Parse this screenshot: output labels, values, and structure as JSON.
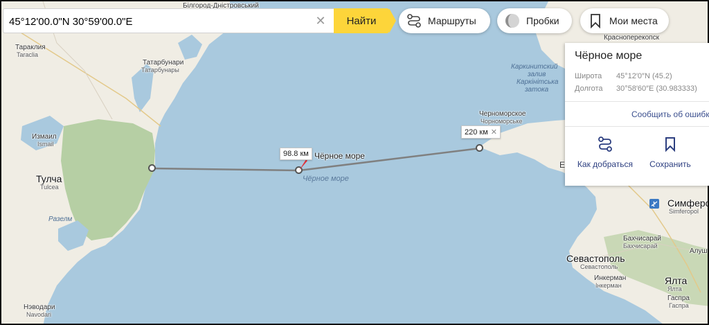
{
  "search": {
    "value": "45°12'00.0\"N 30°59'00.0\"E",
    "clear_icon": "close-icon",
    "find_label": "Найти"
  },
  "toolbar": {
    "routes_label": "Маршруты",
    "routes_icon": "route-icon",
    "traffic_label": "Пробки",
    "traffic_icon": "traffic-circle-icon",
    "places_label": "Мои места",
    "places_icon": "bookmark-icon"
  },
  "panel": {
    "title": "Чёрное море",
    "lat_label": "Широта",
    "lat_value": "45°12′0″N (45.2)",
    "lon_label": "Долгота",
    "lon_value": "30°58′60″E (30.983333)",
    "report_link": "Сообщить об ошибке",
    "route_label": "Как добраться",
    "save_label": "Сохранить"
  },
  "ruler": {
    "segment1_label": "98.8 км",
    "segment2_label": "220 км",
    "remove_icon": "close-icon"
  },
  "map_labels": {
    "bilgorod": "Білгород-Дністровський",
    "tarakliya": "Тараклия",
    "taraclia": "Taraclia",
    "tatarbunary_ua": "Татарбунари",
    "tatarbunary_ru": "Татарбунары",
    "izmail": "Измаил",
    "izmail_ro": "Ismail",
    "tulcha": "Тулча",
    "tulcea": "Tulcea",
    "razelm": "Разелм",
    "navodari": "Нэводари",
    "navodari_ro": "Navodari",
    "black_sea_marker": "Чёрное море",
    "black_sea_italic": "Чёрное море",
    "karkinit_1": "Каркинитский",
    "karkinit_2": "залив",
    "karkinit_3": "Каркінітська",
    "karkinit_4": "затока",
    "chernomorskoe_1": "Черноморское",
    "chernomorskoe_2": "Чорноморське",
    "krasnoperekopsk": "Красноперекопск",
    "simferopol": "Симферополь",
    "simferopol_sub": "Simferopol",
    "bakhchisarai": "Бахчисарай",
    "bakhchisarai_sub": "Бахчисарай",
    "alushta": "Алушта",
    "sevastopol": "Севастополь",
    "sevastopol_sub": "Севастополь",
    "inkerman": "Инкерман",
    "inkerman_sub": "Інкерман",
    "yalta": "Ялта",
    "yalta_sub": "Ялта",
    "gaspra": "Гаспра",
    "gaspra_sub": "Гаспра",
    "ev_partial": "Ев"
  },
  "colors": {
    "sea": "#a9c9de",
    "land": "#f0ede4",
    "steppe": "#b6cfa4",
    "accent": "#fdd53a",
    "pin": "#e0333b",
    "link": "#3b4f8e"
  }
}
